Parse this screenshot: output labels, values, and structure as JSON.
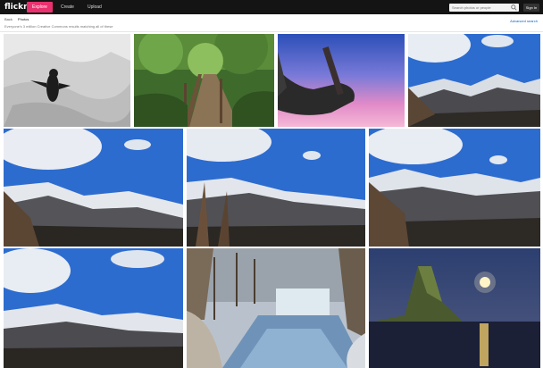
{
  "header": {
    "logo": "flickr",
    "nav": [
      {
        "label": "Explore",
        "active": true
      },
      {
        "label": "Create",
        "active": false
      },
      {
        "label": "Upload",
        "active": false
      }
    ],
    "search_placeholder": "Search photos or people",
    "signin_label": "Sign In"
  },
  "subheader": {
    "breadcrumb": [
      "Back",
      "Photos"
    ],
    "results_text": "Everyone's 3 million Creative Commons results matching all of these",
    "advanced_link": "Advanced search"
  },
  "photos": [
    {
      "name": "penguin-on-snow",
      "subject": "bird in snow"
    },
    {
      "name": "forest-boardwalk",
      "subject": "wooden path in forest"
    },
    {
      "name": "hand-holding-stick",
      "subject": "hand against pink sky"
    },
    {
      "name": "snowy-mountain-1",
      "subject": "snowy mountain range"
    },
    {
      "name": "snowy-mountain-2",
      "subject": "snowy mountain range"
    },
    {
      "name": "snowy-mountain-3",
      "subject": "snowy mountain range"
    },
    {
      "name": "snowy-mountain-4",
      "subject": "snowy mountain range"
    },
    {
      "name": "snowy-mountain-5",
      "subject": "snowy mountain range"
    },
    {
      "name": "frozen-stream",
      "subject": "stream in winter forest"
    },
    {
      "name": "sea-rock-moonrise",
      "subject": "rock in sea at night"
    }
  ],
  "colors": {
    "accent": "#e8316f",
    "link": "#0063dc",
    "topbar": "#141414"
  }
}
